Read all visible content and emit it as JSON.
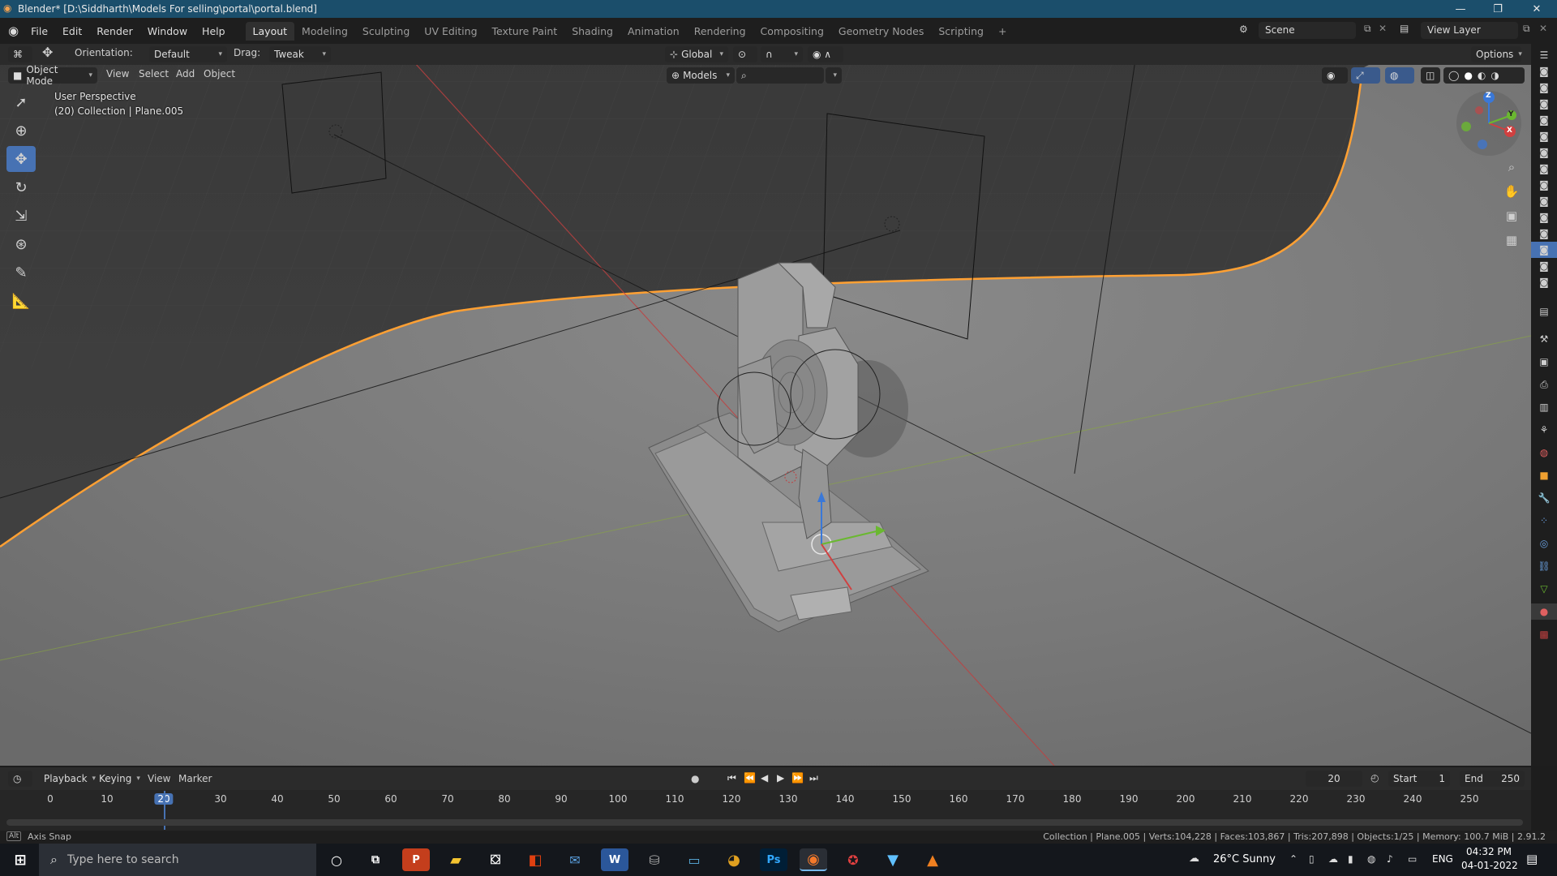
{
  "titlebar": {
    "title": "Blender* [D:\\Siddharth\\Models For selling\\portal\\portal.blend]",
    "minimize": "—",
    "restore": "❐",
    "close": "✕"
  },
  "menubar": {
    "menus": [
      "File",
      "Edit",
      "Render",
      "Window",
      "Help"
    ],
    "workspaces": [
      "Layout",
      "Modeling",
      "Sculpting",
      "UV Editing",
      "Texture Paint",
      "Shading",
      "Animation",
      "Rendering",
      "Compositing",
      "Geometry Nodes",
      "Scripting"
    ],
    "active_workspace": "Layout",
    "add_workspace": "+",
    "scene_label": "Scene",
    "view_layer_label": "View Layer"
  },
  "tool_header": {
    "orientation_label": "Orientation:",
    "orientation_value": "Default",
    "drag_label": "Drag:",
    "drag_value": "Tweak",
    "transform_orientation": "Global",
    "options_label": "Options"
  },
  "view_header": {
    "mode": "Object Mode",
    "menus": [
      "View",
      "Select",
      "Add",
      "Object"
    ],
    "collection_filter": "Models",
    "search_value": ""
  },
  "viewport": {
    "view_name": "User Perspective",
    "collection_info": "(20) Collection | Plane.005",
    "gizmo_axes": [
      "X",
      "Y",
      "Z"
    ]
  },
  "timeline": {
    "menus": [
      "Playback",
      "Keying",
      "View",
      "Marker"
    ],
    "current_frame": "20",
    "start_label": "Start",
    "start_value": "1",
    "end_label": "End",
    "end_value": "250",
    "ticks": [
      "0",
      "10",
      "20",
      "30",
      "40",
      "50",
      "60",
      "70",
      "80",
      "90",
      "100",
      "110",
      "120",
      "130",
      "140",
      "150",
      "160",
      "170",
      "180",
      "190",
      "200",
      "210",
      "220",
      "230",
      "240",
      "250"
    ]
  },
  "statusbar": {
    "left_text": "Axis Snap",
    "right_text": "Collection | Plane.005 | Verts:104,228 | Faces:103,867 | Tris:207,898 | Objects:1/25 | Memory: 100.7 MiB | 2.91.2"
  },
  "taskbar": {
    "search_placeholder": "Type here to search",
    "weather": "26°C  Sunny",
    "language": "ENG",
    "time": "04:32 PM",
    "date": "04-01-2022",
    "apps": [
      "P",
      "W",
      "Ps"
    ]
  },
  "colors": {
    "accent": "#4772b3",
    "titlebar": "#1b4e6b",
    "selection_outline": "#ffa033",
    "x_axis": "#d04040",
    "y_axis": "#7ab33c"
  }
}
